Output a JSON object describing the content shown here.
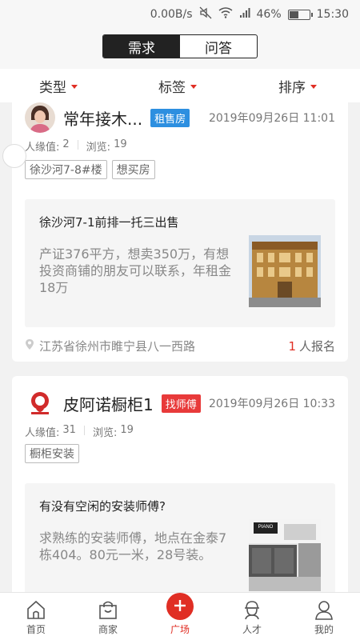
{
  "status_bar": {
    "speed": "0.00B/s",
    "battery_percent": "46%",
    "battery_level": 0.46,
    "time": "15:30"
  },
  "top_tabs": [
    {
      "label": "需求",
      "active": true
    },
    {
      "label": "问答",
      "active": false
    }
  ],
  "filters": [
    {
      "label": "类型"
    },
    {
      "label": "标签"
    },
    {
      "label": "排序"
    }
  ],
  "posts": [
    {
      "name": "常年接木...",
      "badge": "租售房",
      "badge_color": "#2d8fe0",
      "date": "2019年09月26日 11:01",
      "popularity_label": "人缘值:",
      "popularity": "2",
      "views_label": "浏览:",
      "views": "19",
      "tags": [
        "徐沙河7-8#楼",
        "想买房"
      ],
      "title": "徐沙河7-1前排一托三出售",
      "description": "产证376平方，想卖350万，有想投资商铺的朋友可以联系，年租金18万",
      "location": "江苏省徐州市睢宁县八一西路",
      "signup_count": "1",
      "signup_label": "人报名"
    },
    {
      "name": "皮阿诺橱柜1",
      "badge": "找师傅",
      "badge_color": "#e83a3a",
      "date": "2019年09月26日 10:33",
      "popularity_label": "人缘值:",
      "popularity": "31",
      "views_label": "浏览:",
      "views": "19",
      "tags": [
        "橱柜安装"
      ],
      "title": "有没有空闲的安装师傅?",
      "description": "求熟练的安装师傅，地点在金泰7栋404。80元一米，28号装。",
      "thumb_logo": "PIANO"
    }
  ],
  "bottom_nav": [
    {
      "label": "首页",
      "icon": "home-icon"
    },
    {
      "label": "商家",
      "icon": "bag-icon"
    },
    {
      "label": "广场",
      "icon": "plus-icon",
      "active": true
    },
    {
      "label": "人才",
      "icon": "worker-icon"
    },
    {
      "label": "我的",
      "icon": "user-icon"
    }
  ],
  "colors": {
    "accent": "#e02e24",
    "segment_active": "#222222"
  }
}
